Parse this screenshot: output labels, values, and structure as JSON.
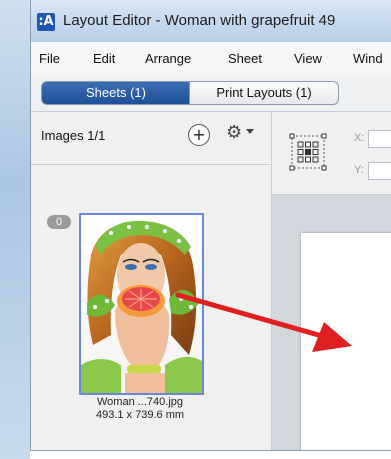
{
  "window": {
    "title": "Layout Editor - Woman with grapefruit 49",
    "app_icon": ":A"
  },
  "menu": {
    "items": [
      "File",
      "Edit",
      "Arrange",
      "Sheet",
      "View",
      "Wind"
    ]
  },
  "tabs": {
    "sheets": "Sheets (1)",
    "print_layouts": "Print Layouts (1)",
    "active": "sheets"
  },
  "images_panel": {
    "title": "Images 1/1",
    "add_icon": "plus-circle-icon",
    "settings_icon": "gear-icon",
    "items": [
      {
        "use_count": "0",
        "filename": "Woman ...740.jpg",
        "dimensions": "493.1 x 739.6 mm"
      }
    ]
  },
  "toolbar": {
    "x_label": "X:",
    "y_label": "Y:"
  },
  "colors": {
    "active_tab": "#1f4f97",
    "selection_border": "#6a86d8",
    "arrow": "#e02020"
  }
}
